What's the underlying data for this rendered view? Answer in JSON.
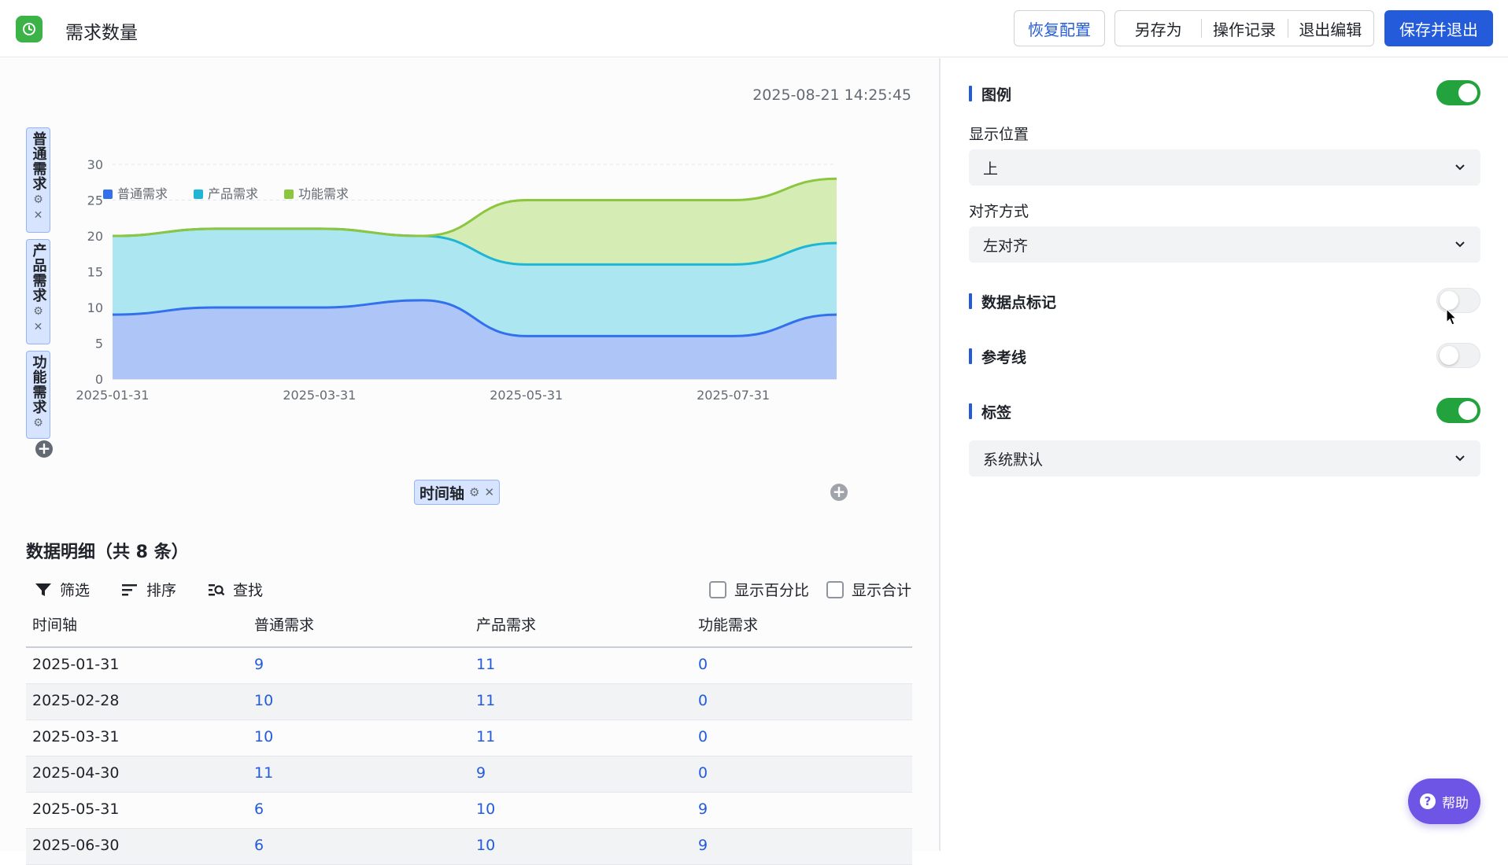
{
  "header": {
    "title": "需求数量",
    "restore_label": "恢复配置",
    "save_as_label": "另存为",
    "history_label": "操作记录",
    "exit_edit_label": "退出编辑",
    "save_exit_label": "保存并退出"
  },
  "left": {
    "timestamp": "2025-08-21 14:25:45",
    "y_fields": [
      "普通需求",
      "产品需求",
      "功能需求"
    ],
    "x_field": "时间轴"
  },
  "chart_data": {
    "type": "area",
    "stacked": true,
    "x": [
      "2025-01-31",
      "2025-02-28",
      "2025-03-31",
      "2025-04-30",
      "2025-05-31",
      "2025-06-30",
      "2025-07-31",
      "2025-08-21"
    ],
    "x_tick_labels": [
      "2025-01-31",
      "2025-03-31",
      "2025-05-31",
      "2025-07-31"
    ],
    "series": [
      {
        "name": "普通需求",
        "color": "#3370eb",
        "values": [
          9,
          10,
          10,
          11,
          6,
          6,
          6,
          9
        ]
      },
      {
        "name": "产品需求",
        "color": "#1fb6d6",
        "values": [
          11,
          11,
          11,
          9,
          10,
          10,
          10,
          10
        ]
      },
      {
        "name": "功能需求",
        "color": "#8cc63e",
        "values": [
          0,
          0,
          0,
          0,
          9,
          9,
          9,
          9
        ]
      }
    ],
    "y_ticks": [
      0,
      5,
      10,
      15,
      20,
      25,
      30
    ],
    "ylim": [
      0,
      30
    ],
    "legend": "top-left",
    "grid": true
  },
  "detail": {
    "title": "数据明细（共 8 条）",
    "tools": {
      "filter": "筛选",
      "sort": "排序",
      "find": "查找"
    },
    "show_percent": "显示百分比",
    "show_total": "显示合计",
    "columns": [
      "时间轴",
      "普通需求",
      "产品需求",
      "功能需求"
    ],
    "rows": [
      [
        "2025-01-31",
        "9",
        "11",
        "0"
      ],
      [
        "2025-02-28",
        "10",
        "11",
        "0"
      ],
      [
        "2025-03-31",
        "10",
        "11",
        "0"
      ],
      [
        "2025-04-30",
        "11",
        "9",
        "0"
      ],
      [
        "2025-05-31",
        "6",
        "10",
        "9"
      ],
      [
        "2025-06-30",
        "6",
        "10",
        "9"
      ]
    ]
  },
  "settings": {
    "legend_title": "图例",
    "legend_on": true,
    "position_label": "显示位置",
    "position_value": "上",
    "align_label": "对齐方式",
    "align_value": "左对齐",
    "marker_title": "数据点标记",
    "marker_on": false,
    "refline_title": "参考线",
    "refline_on": false,
    "label_title": "标签",
    "label_on": true,
    "label_value": "系统默认"
  },
  "help": {
    "label": "帮助"
  }
}
